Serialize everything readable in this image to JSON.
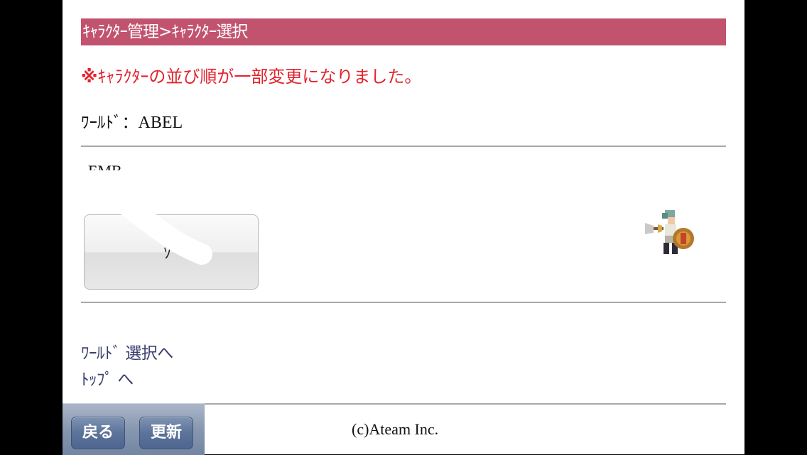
{
  "header": {
    "title": "ｷｬﾗｸﾀｰ管理>ｷｬﾗｸﾀｰ選択"
  },
  "notice": {
    "mark": "※",
    "text": "ｷｬﾗｸﾀｰの並び順が一部変更になりました。"
  },
  "world": {
    "label": "ﾜｰﾙﾄﾞ：",
    "value": "ABEL"
  },
  "character": {
    "name": "EMB",
    "select_label": "ｿﾞ"
  },
  "links": {
    "world_select": "ﾜｰﾙﾄﾞ 選択へ",
    "top": "ﾄｯﾌﾟ へ"
  },
  "footer": {
    "copyright": "(c)Ateam Inc."
  },
  "toolbar": {
    "back_label": "戻る",
    "refresh_label": "更新"
  },
  "colors": {
    "header_bg": "#c2536f",
    "notice_text": "#e0242e",
    "link_text": "#3a3f6e",
    "toolbar_bg": "#8797b0"
  },
  "icons": {
    "character_sprite": "warrior-sprite-icon"
  }
}
